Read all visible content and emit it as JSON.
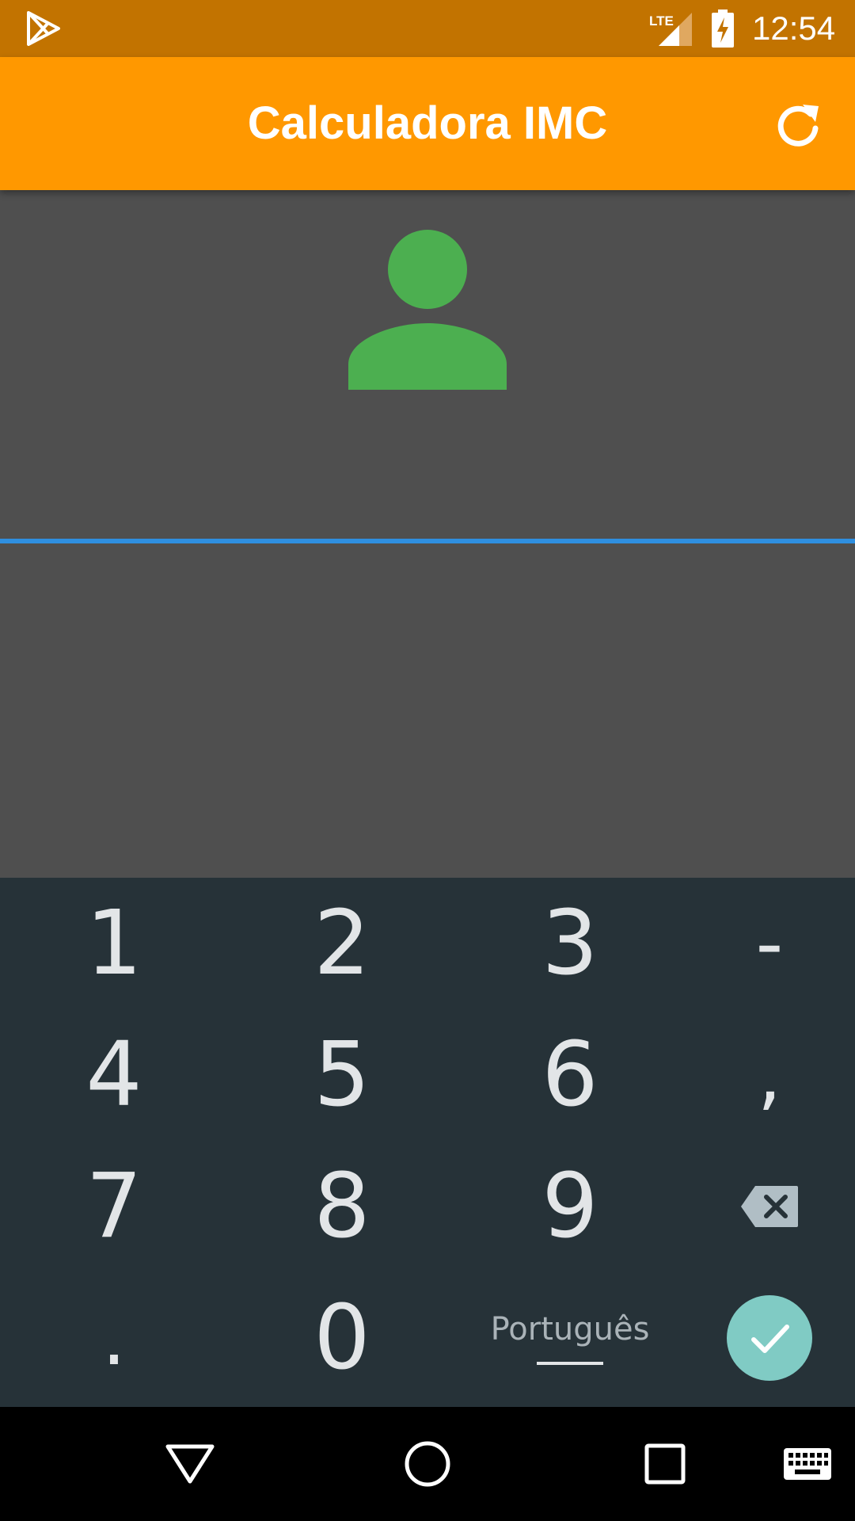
{
  "status_bar": {
    "time": "12:54",
    "network_label": "LTE",
    "icons": [
      "play-store-notification-icon",
      "lte-signal-icon",
      "battery-charging-icon"
    ]
  },
  "app_bar": {
    "title": "Calculadora IMC",
    "refresh_icon": "refresh-icon",
    "background": "#ff9800"
  },
  "content": {
    "avatar_icon": "person-icon",
    "avatar_color": "#4caf50",
    "input_value": "",
    "input_underline_color": "#2f8fe0"
  },
  "keyboard": {
    "rows": [
      [
        "1",
        "2",
        "3",
        "-"
      ],
      [
        "4",
        "5",
        "6",
        ","
      ],
      [
        "7",
        "8",
        "9",
        "⌫"
      ],
      [
        ".",
        "0",
        "Português",
        "✓"
      ]
    ],
    "language_label": "Português",
    "delete_icon": "backspace-icon",
    "done_icon": "check-icon",
    "done_color": "#80cbc4"
  },
  "nav_bar": {
    "buttons": [
      "back-icon",
      "home-icon",
      "recents-icon",
      "keyboard-switch-icon"
    ]
  }
}
